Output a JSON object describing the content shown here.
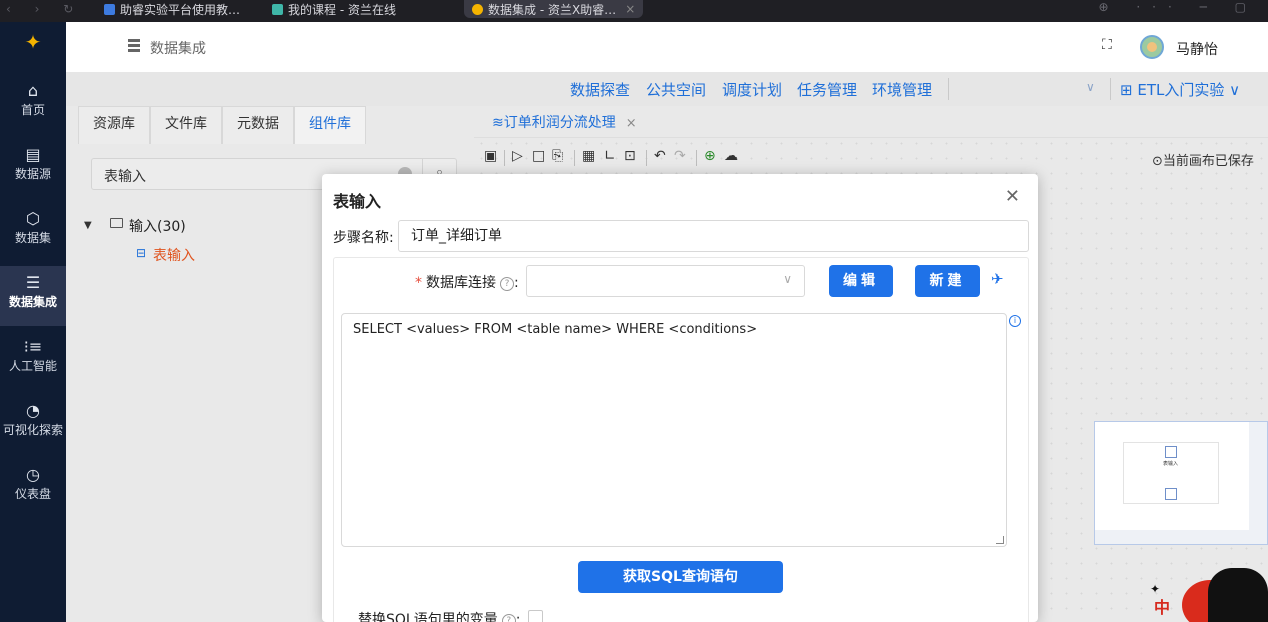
{
  "browser": {
    "tabs": [
      {
        "label": "助睿实验平台使用教…"
      },
      {
        "label": "我的课程 - 资兰在线"
      },
      {
        "label": "数据集成 - 资兰X助睿…"
      }
    ]
  },
  "sidebar": {
    "items": [
      {
        "label": "首页",
        "icon": "home-icon"
      },
      {
        "label": "数据源",
        "icon": "database-source-icon"
      },
      {
        "label": "数据集",
        "icon": "dataset-cube-icon"
      },
      {
        "label": "数据集成",
        "icon": "integration-server-icon",
        "active": true
      },
      {
        "label": "人工智能",
        "icon": "ai-icon"
      },
      {
        "label": "可视化探索",
        "icon": "pie-chart-icon"
      },
      {
        "label": "仪表盘",
        "icon": "dashboard-gauge-icon"
      }
    ]
  },
  "header": {
    "title": "数据集成",
    "user_name": "马静怡"
  },
  "menu": {
    "items": [
      "数据探查",
      "公共空间",
      "调度计划",
      "任务管理",
      "环境管理"
    ],
    "project": "ETL入门实验"
  },
  "left_panel": {
    "tabs": [
      "资源库",
      "文件库",
      "元数据",
      "组件库"
    ],
    "active_tab": "组件库",
    "search_value": "表输入",
    "tree": {
      "folder_label": "输入(30)",
      "child_label": "表输入"
    }
  },
  "editor": {
    "tab_label": "订单利润分流处理",
    "saved_status": "当前画布已保存"
  },
  "minimap": {
    "node_label": "表输入"
  },
  "mascot": {
    "tag": "中"
  },
  "modal": {
    "title": "表输入",
    "step_name_label": "步骤名称:",
    "step_name_value": "订单_详细订单",
    "db_conn_label": "数据库连接",
    "db_conn_value": "",
    "edit_button": "编辑",
    "new_button": "新建",
    "sql_text": "SELECT <values> FROM <table name> WHERE <conditions>",
    "get_sql_button": "获取SQL查询语句",
    "replace_vars_label": "替换SQL语句里的变量"
  },
  "colors": {
    "accent": "#1f72e8",
    "sidebar_bg": "#0f1c33",
    "tree_child": "#e0541f",
    "required": "#e54d3c"
  }
}
